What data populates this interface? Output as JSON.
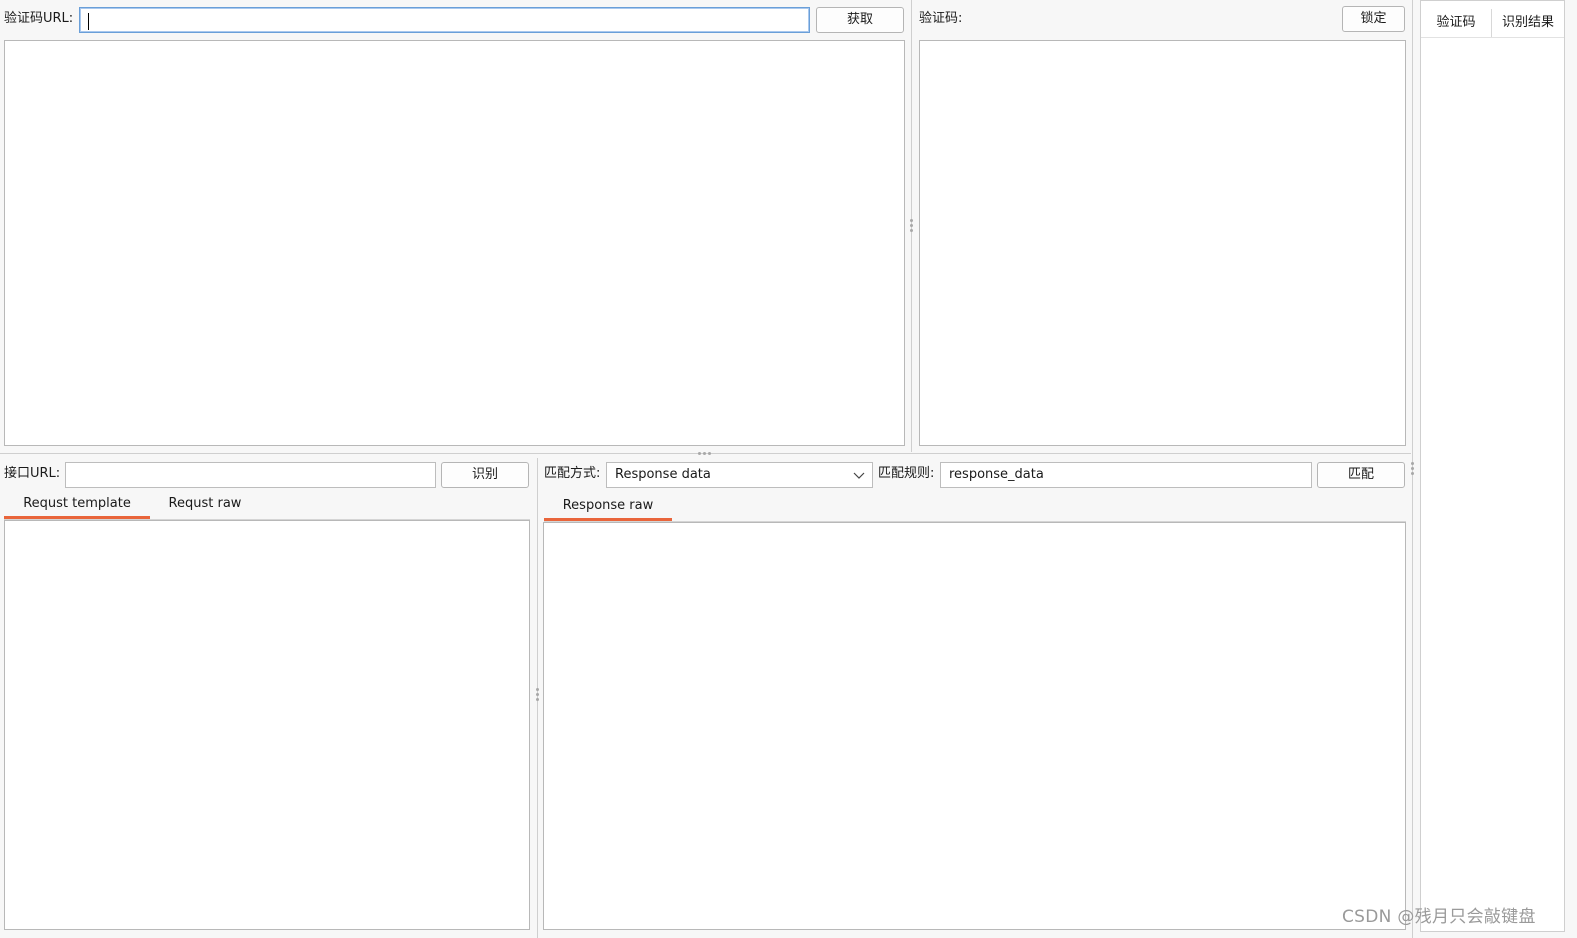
{
  "captcha": {
    "url_label": "验证码URL:",
    "url_value": "",
    "fetch_button": "获取",
    "code_label": "验证码:",
    "lock_button": "锁定"
  },
  "results_table": {
    "columns": [
      "验证码",
      "识别结果"
    ]
  },
  "request": {
    "url_label": "接口URL:",
    "url_value": "",
    "recognize_button": "识别",
    "tabs": [
      {
        "label": "Requst template",
        "active": true
      },
      {
        "label": "Requst raw",
        "active": false
      }
    ]
  },
  "response": {
    "match_mode_label": "匹配方式:",
    "match_mode_value": "Response data",
    "match_rule_label": "匹配规则:",
    "match_rule_value": "response_data",
    "match_button": "匹配",
    "tabs": [
      {
        "label": "Response raw",
        "active": true
      }
    ]
  },
  "watermark": "CSDN @残月只会敲键盘",
  "colors": {
    "tab_active_underline": "#e9653b",
    "focus_border": "#6a9fd8"
  }
}
